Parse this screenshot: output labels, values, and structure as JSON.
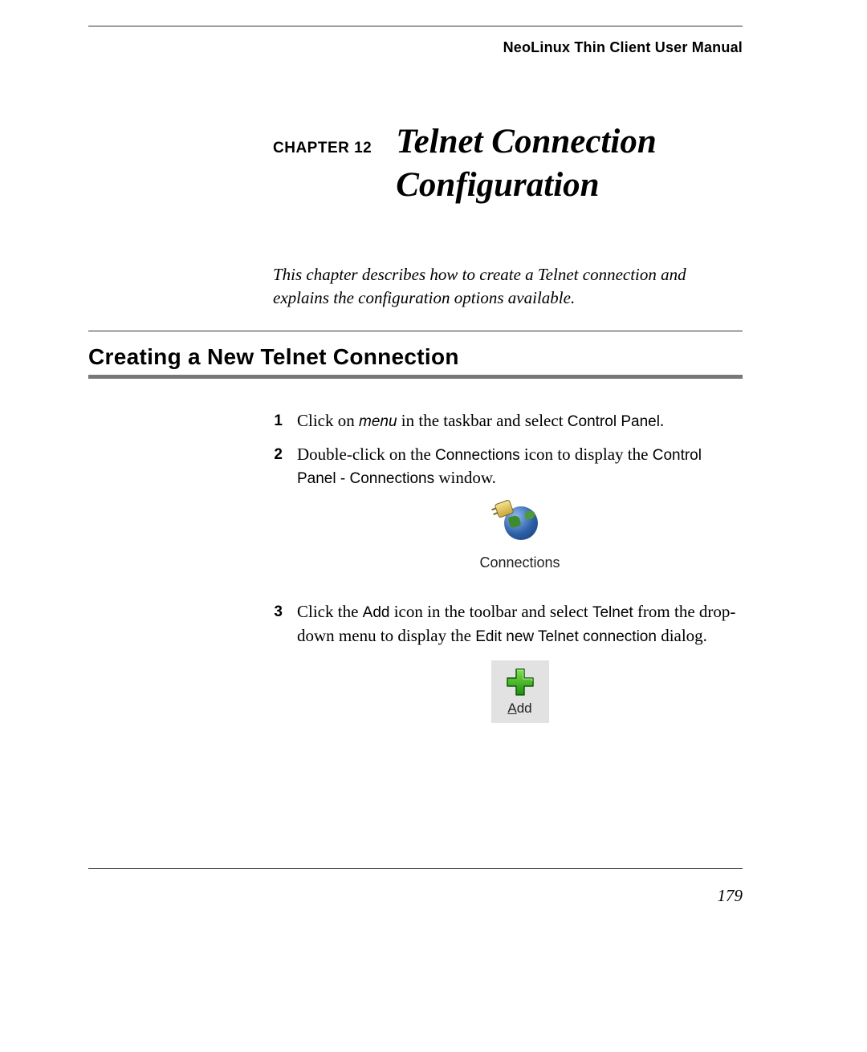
{
  "header": {
    "manual_title": "NeoLinux Thin Client User Manual"
  },
  "chapter": {
    "label": "CHAPTER 12",
    "title_line1": "Telnet Connection",
    "title_line2": "Configuration",
    "intro": "This chapter describes how to create a Telnet connection and explains the configuration options available."
  },
  "section": {
    "heading": "Creating a New Telnet Connection"
  },
  "steps": {
    "s1": {
      "num": "1",
      "pre": "Click on ",
      "menu": "menu",
      "mid": " in the taskbar and select ",
      "ui1": "Control Panel",
      "post": "."
    },
    "s2": {
      "num": "2",
      "pre": "Double-click on the ",
      "ui1": "Connections",
      "mid": " icon to display the ",
      "ui2": "Control Panel - Connections",
      "post": " window."
    },
    "s3": {
      "num": "3",
      "pre": "Click the ",
      "ui1": "Add",
      "mid1": " icon in the toolbar and select ",
      "ui2": "Telnet",
      "mid2": " from the drop-down menu to display the ",
      "ui3": "Edit new Telnet connection",
      "post": " dialog."
    }
  },
  "icons": {
    "connections_caption": "Connections",
    "add_first_letter": "A",
    "add_rest": "dd"
  },
  "footer": {
    "page_number": "179"
  }
}
